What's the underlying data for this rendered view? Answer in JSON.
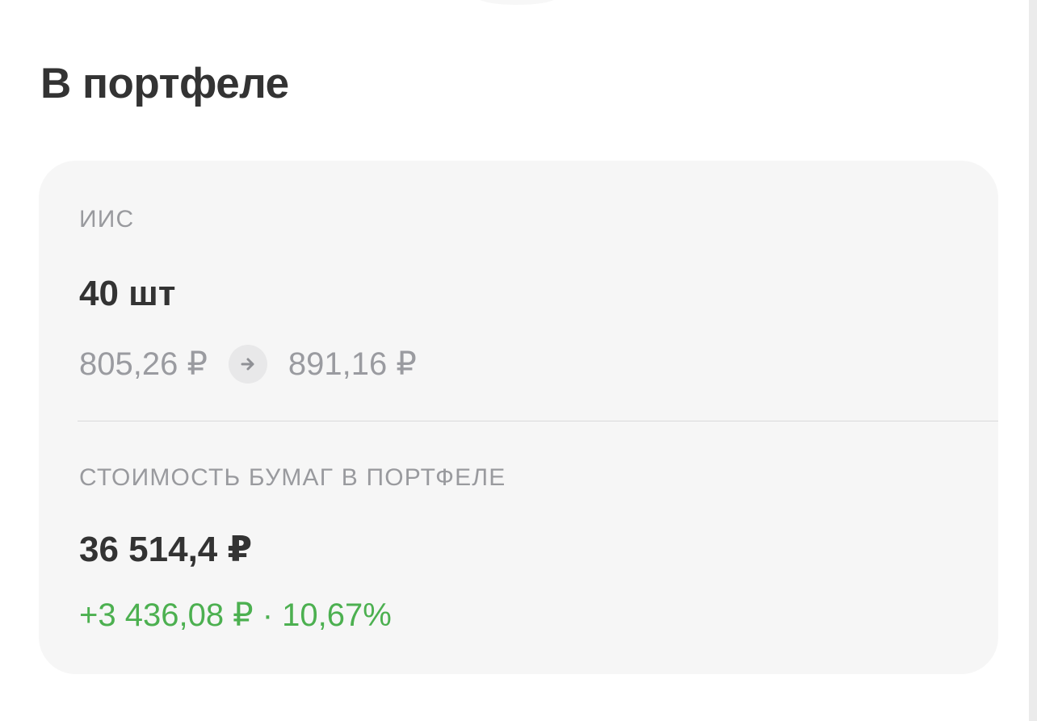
{
  "page": {
    "section_title": "В портфеле"
  },
  "portfolio": {
    "account_label": "ИИС",
    "quantity": "40 шт",
    "avg_price": "805,26 ₽",
    "current_price": "891,16 ₽",
    "arrow_icon": "arrow-right-icon",
    "value_label": "СТОИМОСТЬ БУМАГ В ПОРТФЕЛЕ",
    "total_value": "36 514,4 ₽",
    "change": "+3 436,08 ₽ · 10,67%"
  },
  "colors": {
    "title": "#333333",
    "muted": "#999a9e",
    "positive": "#4cb050",
    "card_background": "#f6f6f6"
  }
}
